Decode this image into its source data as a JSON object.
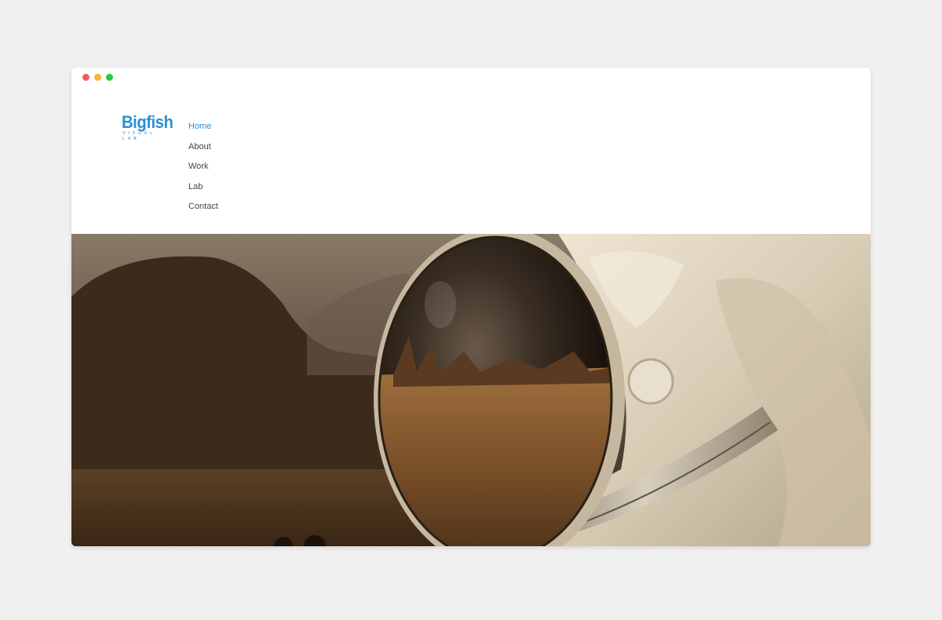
{
  "window": {
    "controls": [
      {
        "name": "close",
        "color": "#f15f56"
      },
      {
        "name": "minimize",
        "color": "#f6b72d"
      },
      {
        "name": "maximize",
        "color": "#2ac940"
      }
    ]
  },
  "brand": {
    "name": "Bigfish",
    "tagline": "VISUAL LAB",
    "color": "#2b8fd1"
  },
  "nav": {
    "active_color": "#2b8fd1",
    "items": [
      {
        "label": "Home",
        "active": true
      },
      {
        "label": "About",
        "active": false
      },
      {
        "label": "Work",
        "active": false
      },
      {
        "label": "Lab",
        "active": false
      },
      {
        "label": "Contact",
        "active": false
      }
    ]
  },
  "hero": {
    "image": "astronaut-helmet-desert-reflection"
  }
}
